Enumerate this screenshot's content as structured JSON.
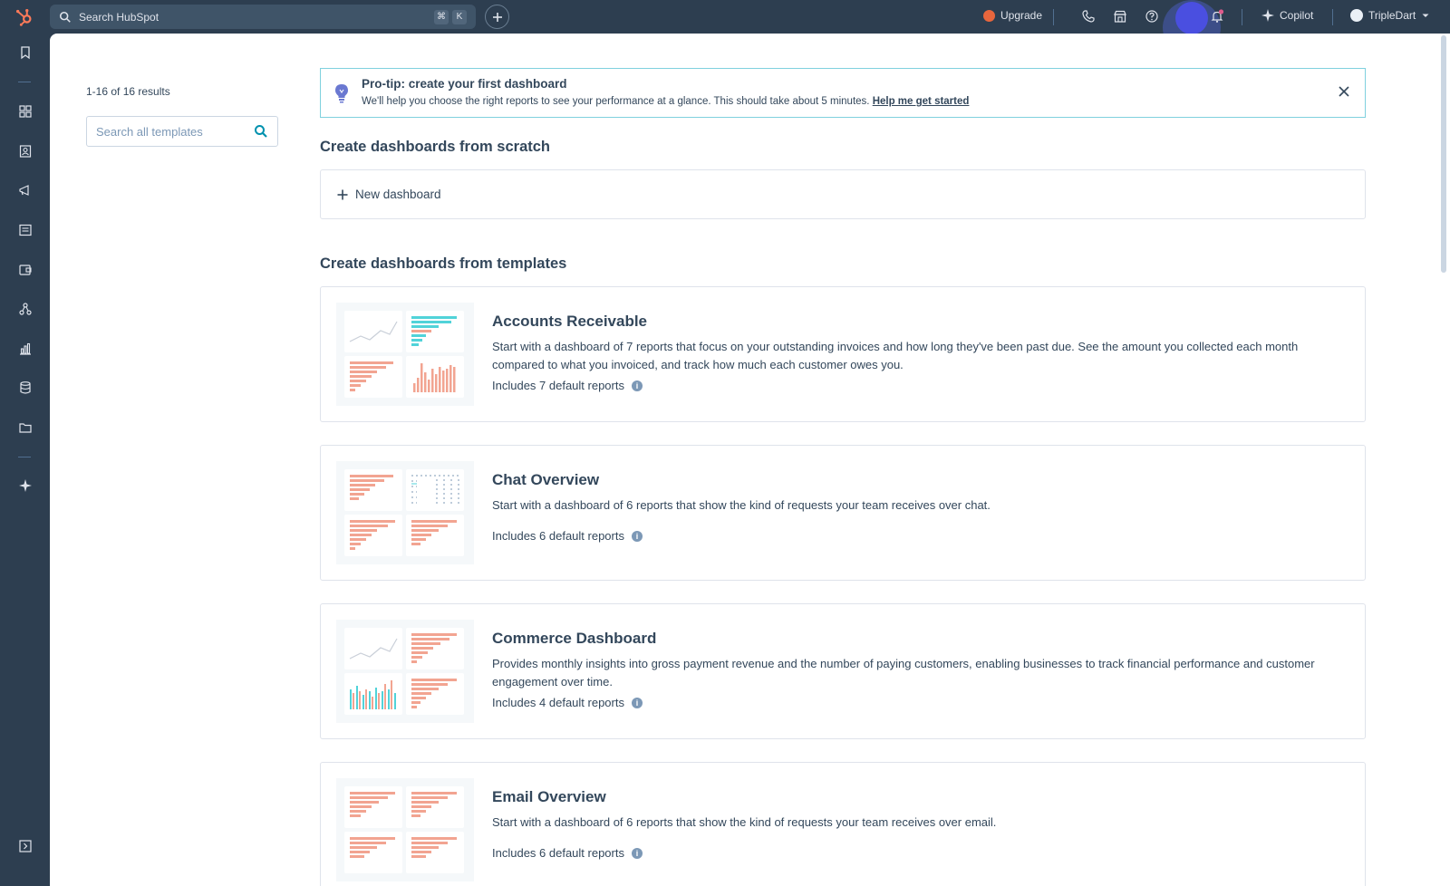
{
  "topbar": {
    "search_label": "Search HubSpot",
    "shortcut_keys": [
      "⌘",
      "K"
    ],
    "upgrade_label": "Upgrade",
    "copilot_label": "Copilot",
    "account_name": "TripleDart",
    "icons": [
      "hubspot-logo-icon",
      "search-icon",
      "plus-icon",
      "upgrade-icon",
      "phone-icon",
      "marketplace-icon",
      "help-icon",
      "settings-icon",
      "notifications-icon",
      "copilot-sparkle-icon",
      "chevron-down-icon"
    ]
  },
  "sidebar": {
    "icons": [
      "bookmark-icon",
      "workspaces-icon",
      "contacts-icon",
      "marketing-icon",
      "content-icon",
      "commerce-icon",
      "automation-icon",
      "reporting-icon",
      "data-management-icon",
      "library-icon",
      "breeze-icon",
      "expand-sidebar-icon"
    ]
  },
  "filters": {
    "results_text": "1-16 of 16 results",
    "search_placeholder": "Search all templates"
  },
  "protip": {
    "title": "Pro-tip: create your first dashboard",
    "description": "We'll help you choose the right reports to see your performance at a glance. This should take about 5 minutes.",
    "link_label": "Help me get started"
  },
  "scratch": {
    "heading": "Create dashboards from scratch",
    "new_dashboard_label": "New dashboard"
  },
  "templates": {
    "heading": "Create dashboards from templates",
    "items": [
      {
        "name": "Accounts Receivable",
        "description": "Start with a dashboard of 7 reports that focus on your outstanding invoices and how long they've been past due. See the amount you collected each month compared to what you invoiced, and track how much each customer owes you.",
        "includes": "Includes 7 default reports"
      },
      {
        "name": "Chat Overview",
        "description": "Start with a dashboard of 6 reports that show the kind of requests your team receives over chat.",
        "includes": "Includes 6 default reports"
      },
      {
        "name": "Commerce Dashboard",
        "description": "Provides monthly insights into gross payment revenue and the number of paying customers, enabling businesses to track financial performance and customer engagement over time.",
        "includes": "Includes 4 default reports"
      },
      {
        "name": "Email Overview",
        "description": "Start with a dashboard of 6 reports that show the kind of requests your team receives over email.",
        "includes": "Includes 6 default reports"
      }
    ]
  },
  "colors": {
    "nav_bg": "#2d3e50",
    "text": "#33475b",
    "accent_teal": "#00bda5",
    "chart_coral": "#f2a491",
    "protip_border": "#7fd1de"
  }
}
